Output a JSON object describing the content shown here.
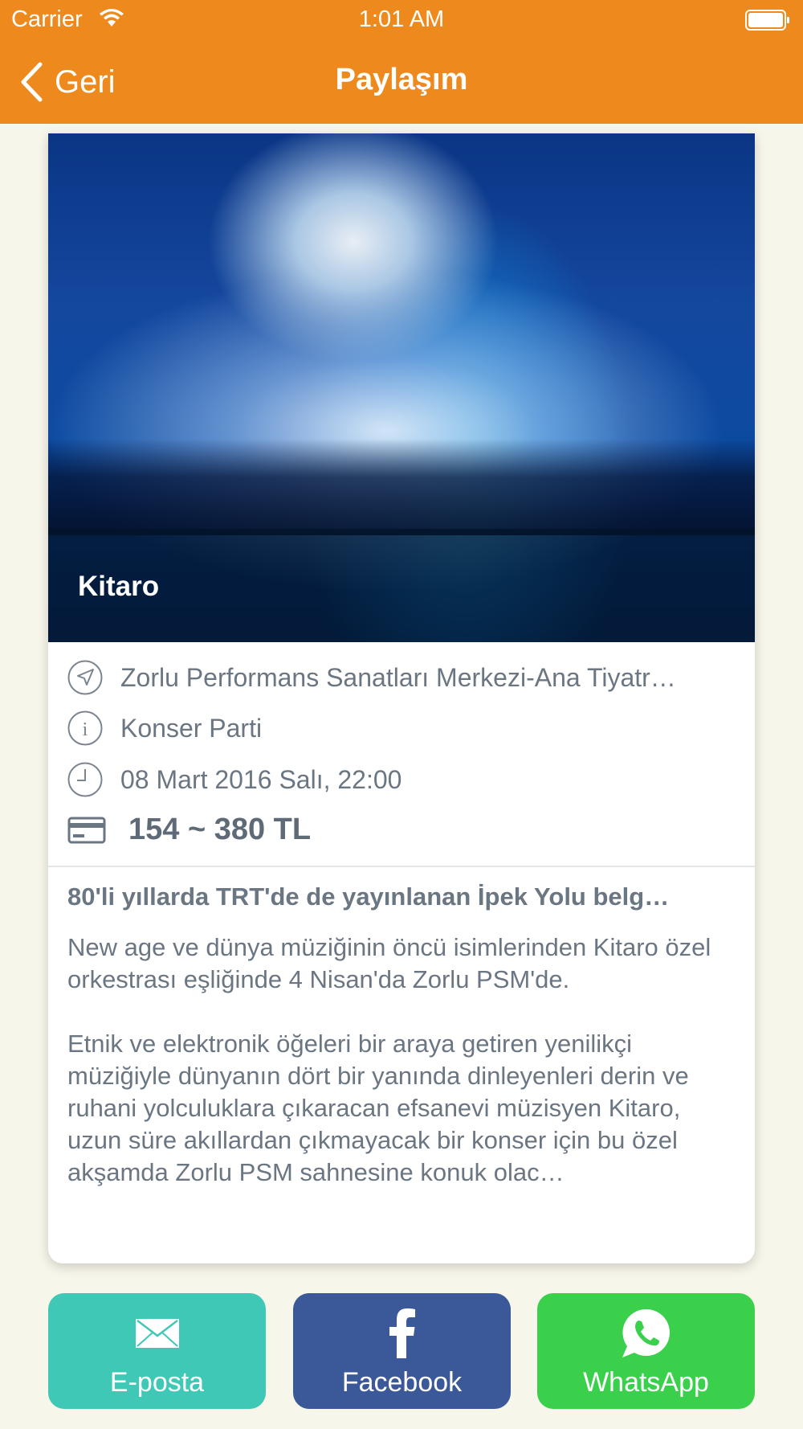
{
  "status_bar": {
    "carrier": "Carrier",
    "time": "1:01 AM"
  },
  "nav": {
    "back_label": "Geri",
    "title": "Paylaşım"
  },
  "event": {
    "title": "Kitaro",
    "venue": "Zorlu Performans Sanatları Merkezi-Ana Tiyatr…",
    "category": "Konser Parti",
    "datetime": "08 Mart 2016 Salı, 22:00",
    "price": "154 ~ 380 TL",
    "headline": "80'li yıllarda TRT'de de yayınlanan İpek Yolu belg…",
    "description_1": "New age ve dünya müziğinin öncü isimlerinden Kitaro özel orkestrası eşliğinde 4 Nisan'da Zorlu PSM'de.",
    "description_2": "Etnik ve elektronik öğeleri bir araya getiren yenilikçi müziğiyle dünyanın dört bir yanında dinleyenleri derin ve ruhani yolculuklara çıkaracan efsanevi müzisyen Kitaro, uzun süre akıllardan çıkmayacak bir konser için bu özel akşamda Zorlu PSM sahnesine konuk olac…"
  },
  "share": {
    "email_label": "E-posta",
    "facebook_label": "Facebook",
    "whatsapp_label": "WhatsApp"
  },
  "colors": {
    "header": "#ee8a1d",
    "background": "#f7f6ea",
    "email": "#3ec8b5",
    "facebook": "#3b5998",
    "whatsapp": "#3bd04c",
    "text": "#6b7683"
  },
  "icons": [
    "wifi-icon",
    "battery-icon",
    "chevron-left-icon",
    "location-arrow-icon",
    "info-icon",
    "clock-icon",
    "credit-card-icon",
    "envelope-icon",
    "facebook-icon",
    "whatsapp-icon"
  ]
}
